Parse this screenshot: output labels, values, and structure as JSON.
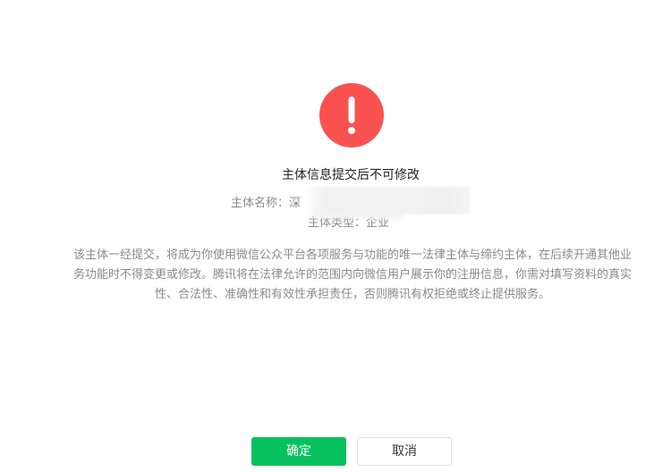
{
  "colors": {
    "warning": "#fa5151",
    "primary": "#07c160",
    "text_muted": "#8a8a8a"
  },
  "dialog": {
    "icon": "exclamation-icon",
    "title": "主体信息提交后不可修改",
    "subject_name_label": "主体名称：",
    "subject_name_value": "深",
    "subject_type_label": "主体类型：",
    "subject_type_value": "企业",
    "description": "该主体一经提交，将成为你使用微信公众平台各项服务与功能的唯一法律主体与缔约主体，在后续开通其他业务功能时不得变更或修改。腾讯将在法律允许的范围内向微信用户展示你的注册信息，你需对填写资料的真实性、合法性、准确性和有效性承担责任，否则腾讯有权拒绝或终止提供服务。",
    "confirm_label": "确定",
    "cancel_label": "取消"
  }
}
